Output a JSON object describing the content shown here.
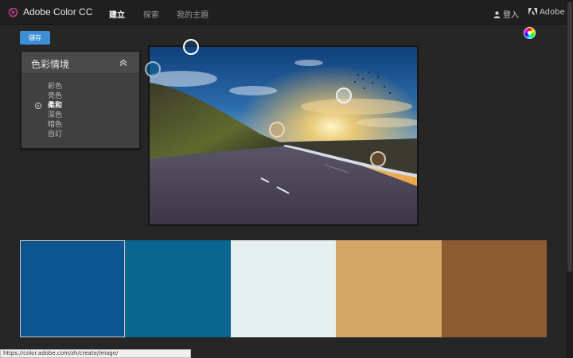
{
  "app": {
    "title": "Adobe Color CC",
    "brand_color": "#c03a8d"
  },
  "nav": {
    "items": [
      {
        "label": "建立",
        "active": true
      },
      {
        "label": "探索",
        "active": false
      },
      {
        "label": "我的主題",
        "active": false
      }
    ],
    "login_label": "登入",
    "adobe_label": "Adobe"
  },
  "toolbar": {
    "save_label": "儲存",
    "save_color": "#3c8fd6"
  },
  "mood_panel": {
    "title": "色彩情境",
    "options": [
      {
        "label": "彩色",
        "selected": false
      },
      {
        "label": "亮色",
        "selected": false
      },
      {
        "label": "柔和",
        "selected": true
      },
      {
        "label": "深色",
        "selected": false
      },
      {
        "label": "暗色",
        "selected": false
      },
      {
        "label": "自訂",
        "selected": false
      }
    ]
  },
  "swatches": [
    {
      "color": "#0b548f",
      "selected": true
    },
    {
      "color": "#0a658f"
    },
    {
      "color": "#e6f0ee"
    },
    {
      "color": "#d4a769"
    },
    {
      "color": "#8c5b32"
    }
  ],
  "pickers": [
    {
      "color": "#0b548f",
      "selected": true
    },
    {
      "color": "#0a658f"
    },
    {
      "color": "#e6f0ee"
    },
    {
      "color": "#d4a769"
    },
    {
      "color": "#8c5b32"
    }
  ],
  "status_bar": {
    "url": "https://color.adobe.com/zh/create/image/"
  }
}
